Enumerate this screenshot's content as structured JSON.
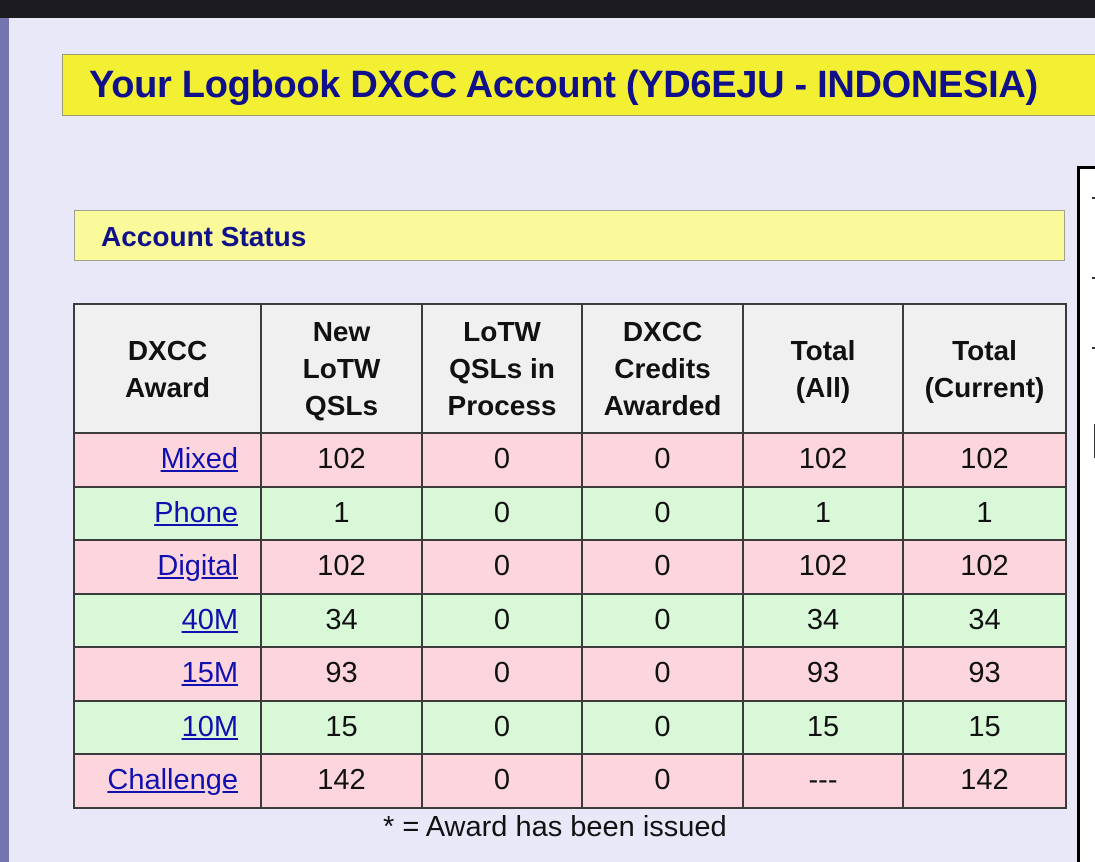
{
  "page": {
    "title": "Your Logbook DXCC Account (YD6EJU - INDONESIA)",
    "section_title": "Account Status",
    "footnote": "* = Award has been issued"
  },
  "table": {
    "headers": [
      [
        "DXCC",
        "Award"
      ],
      [
        "New",
        "LoTW",
        "QSLs"
      ],
      [
        "LoTW",
        "QSLs in",
        "Process"
      ],
      [
        "DXCC",
        "Credits",
        "Awarded"
      ],
      [
        "Total",
        "(All)"
      ],
      [
        "Total",
        "(Current)"
      ]
    ],
    "rows": [
      {
        "award": "Mixed",
        "new_lotw": "102",
        "in_process": "0",
        "credits": "0",
        "total_all": "102",
        "total_current": "102",
        "shade": "pink"
      },
      {
        "award": "Phone",
        "new_lotw": "1",
        "in_process": "0",
        "credits": "0",
        "total_all": "1",
        "total_current": "1",
        "shade": "green"
      },
      {
        "award": "Digital",
        "new_lotw": "102",
        "in_process": "0",
        "credits": "0",
        "total_all": "102",
        "total_current": "102",
        "shade": "pink"
      },
      {
        "award": "40M",
        "new_lotw": "34",
        "in_process": "0",
        "credits": "0",
        "total_all": "34",
        "total_current": "34",
        "shade": "green"
      },
      {
        "award": "15M",
        "new_lotw": "93",
        "in_process": "0",
        "credits": "0",
        "total_all": "93",
        "total_current": "93",
        "shade": "pink"
      },
      {
        "award": "10M",
        "new_lotw": "15",
        "in_process": "0",
        "credits": "0",
        "total_all": "15",
        "total_current": "15",
        "shade": "green"
      },
      {
        "award": "Challenge",
        "new_lotw": "142",
        "in_process": "0",
        "credits": "0",
        "total_all": "---",
        "total_current": "142",
        "shade": "pink"
      }
    ]
  },
  "colors": {
    "title_bg": "#f3f034",
    "section_bg": "#fafa9a",
    "heading_text": "#10108a",
    "link": "#1010b0",
    "row_pink": "#fcd6dc",
    "row_green": "#d9f8d8",
    "header_bg": "#f0f0f0"
  }
}
